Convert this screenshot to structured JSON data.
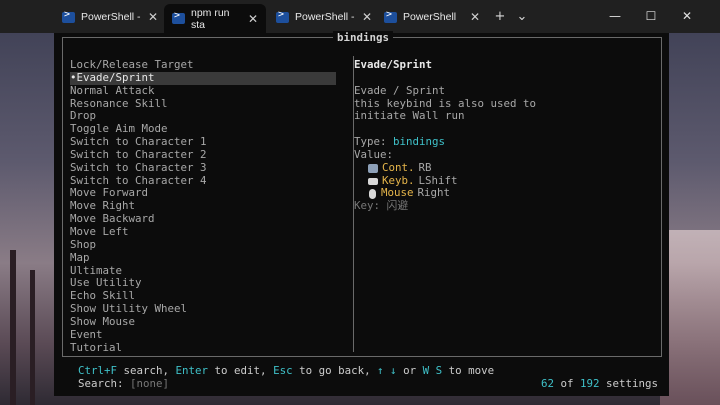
{
  "tabs": [
    {
      "title": "PowerShell -",
      "active": false
    },
    {
      "title": "npm run sta",
      "active": true
    },
    {
      "title": "PowerShell -",
      "active": false
    },
    {
      "title": "PowerShell",
      "active": false
    }
  ],
  "tab_controls": {
    "new_tab": "+",
    "dropdown": "⌄"
  },
  "window_controls": {
    "minimize": "—",
    "maximize": "☐",
    "close": "✕"
  },
  "pane": {
    "title": "bindings"
  },
  "list": {
    "items": [
      "Lock/Release Target",
      "•Evade/Sprint",
      "Normal Attack",
      "Resonance Skill",
      "Drop",
      "Toggle Aim Mode",
      "Switch to Character 1",
      "Switch to Character 2",
      "Switch to Character 3",
      "Switch to Character 4",
      "Move Forward",
      "Move Right",
      "Move Backward",
      "Move Left",
      "Shop",
      "Map",
      "Ultimate",
      "Use Utility",
      "Echo Skill",
      "Show Utility Wheel",
      "Show Mouse",
      "Event",
      "Tutorial"
    ],
    "selected_index": 1
  },
  "detail": {
    "title": "Evade/Sprint",
    "description_lines": [
      "Evade / Sprint",
      "this keybind is also used to",
      "initiate Wall run"
    ],
    "type_label": "Type:",
    "type_value": "bindings",
    "value_label": "Value:",
    "values": [
      {
        "icon": "gamepad-icon",
        "device": "Cont.",
        "binding": "RB"
      },
      {
        "icon": "keyboard-icon",
        "device": "Keyb.",
        "binding": "LShift"
      },
      {
        "icon": "mouse-icon",
        "device": "Mouse",
        "binding": "Right"
      }
    ],
    "key_label": "Key:",
    "key_value": "闪避"
  },
  "footer": {
    "hint": {
      "k1": "Ctrl+F",
      "t1": " search, ",
      "k2": "Enter",
      "t2": " to edit, ",
      "k3": "Esc",
      "t3": " to go back, ",
      "k4": "↑ ↓",
      "t4": " or ",
      "k5": "W S",
      "t5": " to move"
    },
    "search_label": "Search:",
    "search_value": "[none]",
    "count_current": "62",
    "count_of": " of ",
    "count_total": "192",
    "count_suffix": " settings"
  },
  "colors": {
    "accent": "#3fc1c9",
    "device": "#e5b54a",
    "terminal_bg": "#0c0c0c"
  }
}
